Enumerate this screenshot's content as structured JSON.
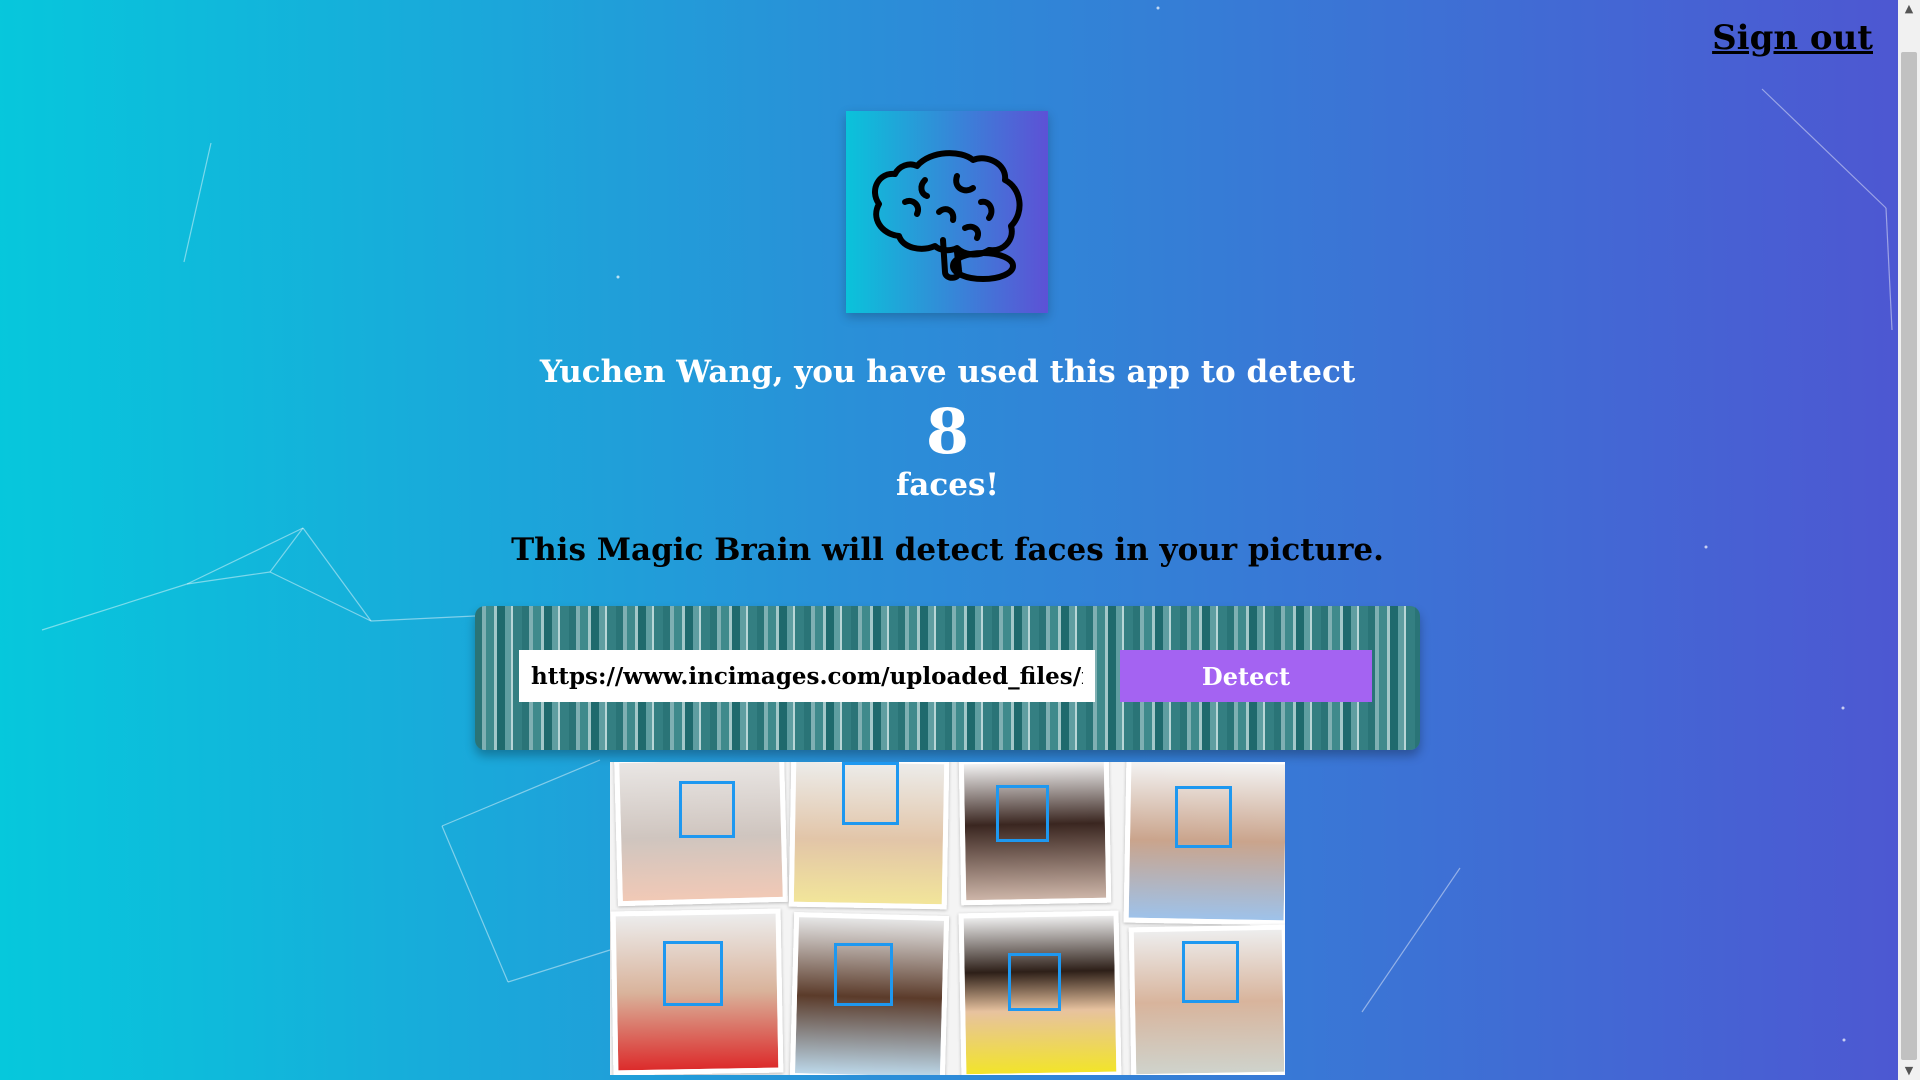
{
  "nav": {
    "signout_label": "Sign out"
  },
  "logo": {
    "icon": "brain-icon",
    "bg_from": "#0ac3da",
    "bg_to": "#5d51d6"
  },
  "rank": {
    "line": "Yuchen Wang, you have used this app to detect",
    "count": "8",
    "suffix": "faces!"
  },
  "tagline": "This Magic Brain will detect faces in your picture.",
  "form": {
    "url_value": "https://www.incimages.com/uploaded_files/image/",
    "detect_label": "Detect",
    "button_color": "#a463f2"
  },
  "results": {
    "faces_detected": 8,
    "box_color": "#1e98f0"
  },
  "colors": {
    "bg_left": "#06c8dc",
    "bg_right": "#4e56d2"
  }
}
